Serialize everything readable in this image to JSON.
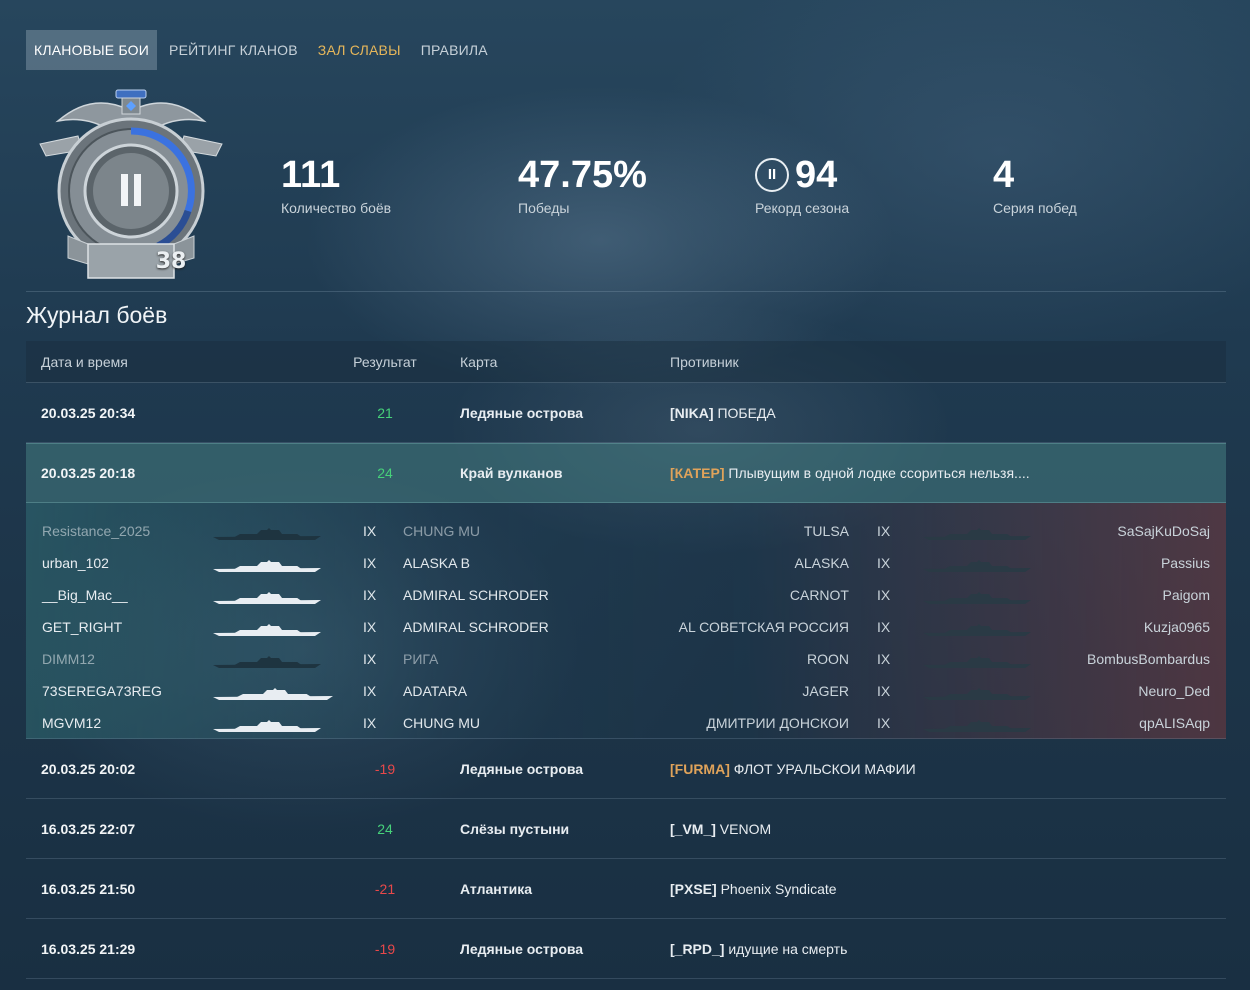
{
  "nav": {
    "tabs": [
      {
        "label": "КЛАНОВЫЕ БОИ",
        "active": true
      },
      {
        "label": "РЕЙТИНГ КЛАНОВ",
        "active": false
      },
      {
        "label": "ЗАЛ СЛАВЫ",
        "active": false,
        "highlight": "#e6b65a"
      },
      {
        "label": "ПРАВИЛА",
        "active": false
      }
    ]
  },
  "emblem": {
    "league_numeral": "II",
    "rating_number": "38",
    "icon": "league-emblem-icon"
  },
  "stats": {
    "battles": {
      "value": "111",
      "label": "Количество боёв"
    },
    "wins": {
      "value": "47.75%",
      "label": "Победы"
    },
    "record": {
      "badge": "II",
      "value": "94",
      "label": "Рекорд сезона"
    },
    "streak": {
      "value": "4",
      "label": "Серия побед"
    }
  },
  "log": {
    "title": "Журнал боёв",
    "headers": {
      "date": "Дата и время",
      "result": "Результат",
      "map": "Карта",
      "opponent": "Противник"
    },
    "rows": [
      {
        "date": "20.03.25 20:34",
        "result": "21",
        "outcome": "win",
        "map": "Ледяные острова",
        "tag": "[NIKA]",
        "tag_color": "white",
        "name": "ПОБЕДА"
      },
      {
        "date": "20.03.25 20:18",
        "result": "24",
        "outcome": "win",
        "map": "Край вулканов",
        "tag": "[КАТЕР]",
        "tag_color": "orange",
        "name": "Плывущим в одной лодке ссориться нельзя....",
        "expanded": true
      },
      {
        "date": "20.03.25 20:02",
        "result": "-19",
        "outcome": "loss",
        "map": "Ледяные острова",
        "tag": "[FURMA]",
        "tag_color": "orange",
        "name": "ФЛОТ УРАЛЬСКОИ МАФИИ"
      },
      {
        "date": "16.03.25 22:07",
        "result": "24",
        "outcome": "win",
        "map": "Слёзы пустыни",
        "tag": "[_VM_]",
        "tag_color": "white",
        "name": "VENOM"
      },
      {
        "date": "16.03.25 21:50",
        "result": "-21",
        "outcome": "loss",
        "map": "Атлантика",
        "tag": "[PXSE]",
        "tag_color": "white",
        "name": "Phoenix Syndicate"
      },
      {
        "date": "16.03.25 21:29",
        "result": "-19",
        "outcome": "loss",
        "map": "Ледяные острова",
        "tag": "[_RPD_]",
        "tag_color": "white",
        "name": "идущие на смерть"
      }
    ]
  },
  "battle_details": {
    "players": [
      {
        "left_name": "Resistance_2025",
        "left_tier": "IX",
        "left_ship": "CHUNG MU",
        "left_alive": false,
        "right_ship": "TULSA",
        "right_tier": "IX",
        "right_name": "SaSajKuDoSaj",
        "right_alive": false
      },
      {
        "left_name": "urban_102",
        "left_tier": "IX",
        "left_ship": "ALASKA B",
        "left_alive": true,
        "right_ship": "ALASKA",
        "right_tier": "IX",
        "right_name": "Passius",
        "right_alive": false
      },
      {
        "left_name": "__Big_Mac__",
        "left_tier": "IX",
        "left_ship": "ADMIRAL SCHRODER",
        "left_alive": true,
        "right_ship": "CARNOT",
        "right_tier": "IX",
        "right_name": "Paigom",
        "right_alive": false
      },
      {
        "left_name": "GET_RIGHT",
        "left_tier": "IX",
        "left_ship": "ADMIRAL SCHRODER",
        "left_alive": true,
        "right_ship": "AL СОВЕТСКАЯ РОССИЯ",
        "right_tier": "IX",
        "right_name": "Kuzja0965",
        "right_alive": false
      },
      {
        "left_name": "DIMM12",
        "left_tier": "IX",
        "left_ship": "РИГА",
        "left_alive": false,
        "right_ship": "ROON",
        "right_tier": "IX",
        "right_name": "BombusBombardus",
        "right_alive": false
      },
      {
        "left_name": "73SEREGA73REG",
        "left_tier": "IX",
        "left_ship": "ADATARA",
        "left_alive": true,
        "right_ship": "JAGER",
        "right_tier": "IX",
        "right_name": "Neuro_Ded",
        "right_alive": false
      },
      {
        "left_name": "MGVM12",
        "left_tier": "IX",
        "left_ship": "CHUNG MU",
        "left_alive": true,
        "right_ship": "ДМИТРИИ ДОНСКОИ",
        "right_tier": "IX",
        "right_name": "qpALISAqp",
        "right_alive": false
      }
    ]
  },
  "colors": {
    "win": "#46d17a",
    "loss": "#e8484a",
    "tag_orange": "#e0a35a",
    "gold": "#e6b65a"
  }
}
